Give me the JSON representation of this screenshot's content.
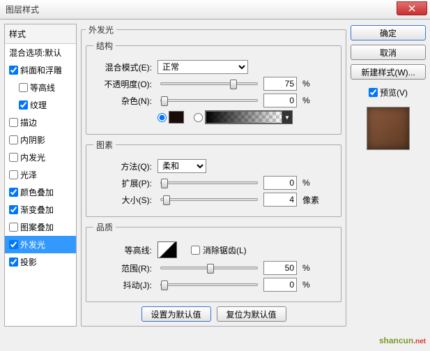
{
  "title": "图层样式",
  "sidebar": {
    "header": "样式",
    "blend_options": "混合选项:默认",
    "items": [
      {
        "label": "斜面和浮雕",
        "checked": true,
        "indent": false
      },
      {
        "label": "等高线",
        "checked": false,
        "indent": true
      },
      {
        "label": "纹理",
        "checked": true,
        "indent": true
      },
      {
        "label": "描边",
        "checked": false,
        "indent": false
      },
      {
        "label": "内阴影",
        "checked": false,
        "indent": false
      },
      {
        "label": "内发光",
        "checked": false,
        "indent": false
      },
      {
        "label": "光泽",
        "checked": false,
        "indent": false
      },
      {
        "label": "颜色叠加",
        "checked": true,
        "indent": false
      },
      {
        "label": "渐变叠加",
        "checked": true,
        "indent": false
      },
      {
        "label": "图案叠加",
        "checked": false,
        "indent": false
      },
      {
        "label": "外发光",
        "checked": true,
        "indent": false,
        "selected": true
      },
      {
        "label": "投影",
        "checked": true,
        "indent": false
      }
    ]
  },
  "panel": {
    "title": "外发光",
    "structure": {
      "legend": "结构",
      "blend_mode_label": "混合模式(E):",
      "blend_mode_value": "正常",
      "opacity_label": "不透明度(O):",
      "opacity_value": "75",
      "opacity_unit": "%",
      "noise_label": "杂色(N):",
      "noise_value": "0",
      "noise_unit": "%"
    },
    "elements": {
      "legend": "图素",
      "technique_label": "方法(Q):",
      "technique_value": "柔和",
      "spread_label": "扩展(P):",
      "spread_value": "0",
      "spread_unit": "%",
      "size_label": "大小(S):",
      "size_value": "4",
      "size_unit": "像素"
    },
    "quality": {
      "legend": "品质",
      "contour_label": "等高线:",
      "antialias_label": "消除锯齿(L)",
      "range_label": "范围(R):",
      "range_value": "50",
      "range_unit": "%",
      "jitter_label": "抖动(J):",
      "jitter_value": "0",
      "jitter_unit": "%"
    },
    "footer": {
      "set_default": "设置为默认值",
      "reset_default": "复位为默认值"
    }
  },
  "buttons": {
    "ok": "确定",
    "cancel": "取消",
    "new_style": "新建样式(W)...",
    "preview": "预览(V)"
  },
  "watermark": "shancun"
}
